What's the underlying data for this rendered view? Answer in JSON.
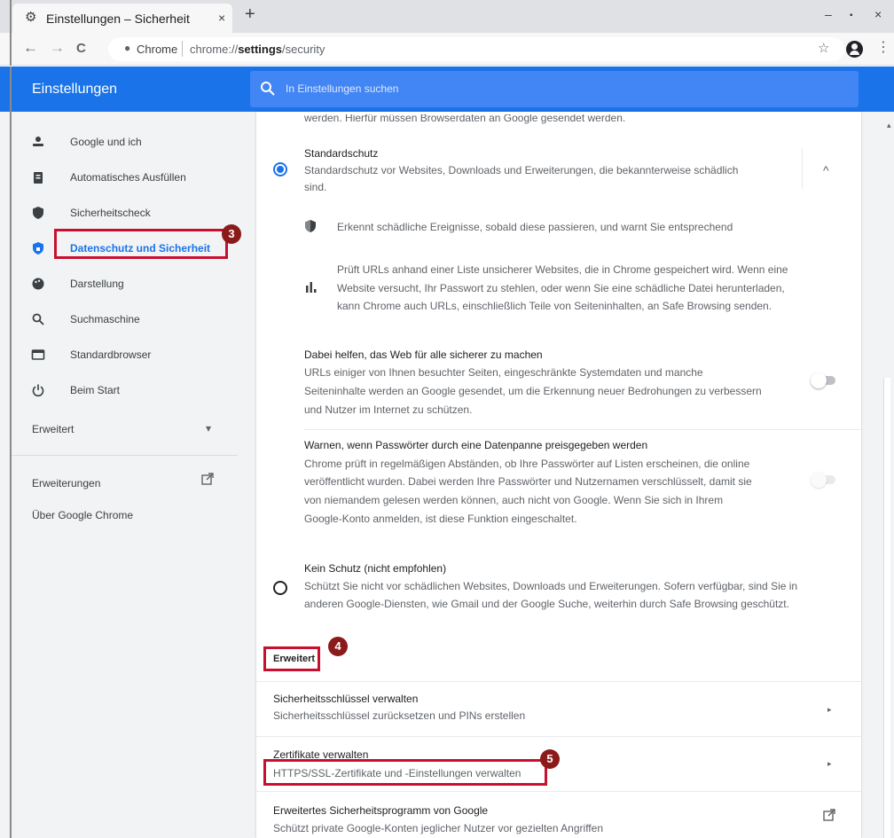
{
  "browser": {
    "tab_title": "Einstellungen – Sicherheit",
    "tab_close": "×",
    "new_tab": "+",
    "window_controls": [
      "–",
      "▪",
      "×"
    ],
    "nav": {
      "back": "←",
      "forward": "→",
      "reload": "C"
    },
    "omnibox": {
      "site_label": "Chrome",
      "url_prefix": "chrome://",
      "url_bold": "settings",
      "url_suffix": "/security"
    },
    "star": "☆",
    "menu": "⋮"
  },
  "header": {
    "title": "Einstellungen",
    "search_placeholder": "In Einstellungen suchen",
    "accent": "#1a73e8"
  },
  "sidebar": {
    "items": [
      {
        "label": "Google und ich",
        "icon": "person-icon",
        "glyph": "👤"
      },
      {
        "label": "Automatisches Ausfüllen",
        "icon": "clipboard-icon",
        "glyph": "📋"
      },
      {
        "label": "Sicherheitscheck",
        "icon": "shield-icon",
        "glyph": "⛊"
      },
      {
        "label": "Datenschutz und Sicherheit",
        "icon": "shield-lock-icon",
        "glyph": "⛨",
        "active": true
      },
      {
        "label": "Darstellung",
        "icon": "palette-icon",
        "glyph": "🎨"
      },
      {
        "label": "Suchmaschine",
        "icon": "search-icon",
        "glyph": "🔍"
      },
      {
        "label": "Standardbrowser",
        "icon": "browser-icon",
        "glyph": "▭"
      },
      {
        "label": "Beim Start",
        "icon": "power-icon",
        "glyph": "⏻"
      }
    ],
    "advanced_label": "Erweitert",
    "advanced_chevron": "▾",
    "extensions_label": "Erweiterungen",
    "about_label": "Über Google Chrome"
  },
  "content": {
    "top_cut_text": "werden. Hierfür müssen Browserdaten an Google gesendet werden.",
    "standard": {
      "title": "Standardschutz",
      "desc_line1": "Standardschutz vor Websites, Downloads und Erweiterungen, die bekannterweise schädlich",
      "desc_line2": "sind.",
      "collapse": "^",
      "selected": true,
      "point1": "Erkennt schädliche Ereignisse, sobald diese passieren, und warnt Sie entsprechend",
      "point2_line1": "Prüft URLs anhand einer Liste unsicherer Websites, die in Chrome gespeichert wird. Wenn eine",
      "point2_line2": "Website versucht, Ihr Passwort zu stehlen, oder wenn Sie eine schädliche Datei herunterladen,",
      "point2_line3": "kann Chrome auch URLs, einschließlich Teile von Seiteninhalten, an Safe Browsing senden."
    },
    "help_web": {
      "title": "Dabei helfen, das Web für alle sicherer zu machen",
      "line1": "URLs einiger von Ihnen besuchter Seiten, eingeschränkte Systemdaten und manche",
      "line2": "Seiteninhalte werden an Google gesendet, um die Erkennung neuer Bedrohungen zu verbessern",
      "line3": "und Nutzer im Internet zu schützen.",
      "enabled": false
    },
    "password_warn": {
      "title": "Warnen, wenn Passwörter durch eine Datenpanne preisgegeben werden",
      "line1": "Chrome prüft in regelmäßigen Abständen, ob Ihre Passwörter auf Listen erscheinen, die online",
      "line2": "veröffentlicht wurden. Dabei werden Ihre Passwörter und Nutzernamen verschlüsselt, damit sie",
      "line3": "von niemandem gelesen werden können, auch nicht von Google. Wenn Sie sich in Ihrem",
      "line4": "Google-Konto anmelden, ist diese Funktion eingeschaltet.",
      "enabled": false
    },
    "no_protection": {
      "title": "Kein Schutz (nicht empfohlen)",
      "line1": "Schützt Sie nicht vor schädlichen Websites, Downloads und Erweiterungen. Sofern verfügbar, sind Sie in",
      "line2": "anderen Google-Diensten, wie Gmail und der Google Suche, weiterhin durch Safe Browsing geschützt.",
      "selected": false
    },
    "advanced_heading": "Erweitert",
    "security_keys": {
      "title": "Sicherheitsschlüssel verwalten",
      "desc": "Sicherheitsschlüssel zurücksetzen und PINs erstellen"
    },
    "certificates": {
      "title": "Zertifikate verwalten",
      "desc": "HTTPS/SSL-Zertifikate und -Einstellungen verwalten"
    },
    "advanced_protection": {
      "title": "Erweitertes Sicherheitsprogramm von Google",
      "desc": "Schützt private Google-Konten jeglicher Nutzer vor gezielten Angriffen"
    },
    "row_arrow": "▸"
  },
  "annotations": {
    "color": "#c8102e",
    "badges": [
      "3",
      "4",
      "5"
    ]
  }
}
